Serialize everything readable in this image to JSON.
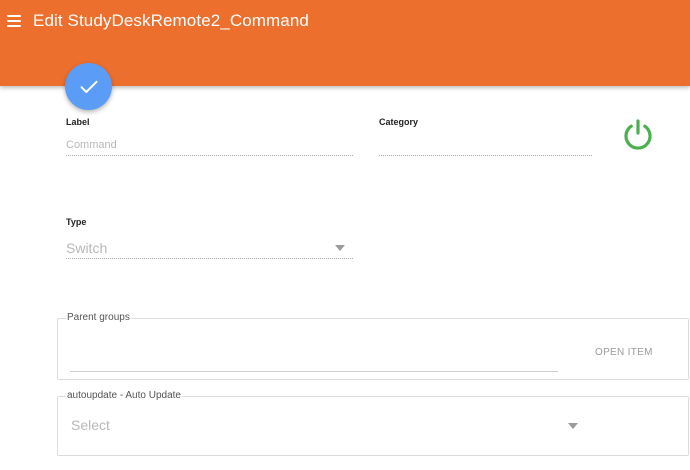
{
  "header": {
    "title": "Edit StudyDeskRemote2_Command",
    "background": "#ec6f2e"
  },
  "fab": {
    "icon": "check-icon",
    "color": "#5b9cf6"
  },
  "form": {
    "label": {
      "caption": "Label",
      "placeholder": "Command"
    },
    "category": {
      "caption": "Category",
      "value": ""
    },
    "power": {
      "icon": "power-icon",
      "color": "#4caf50"
    },
    "type": {
      "caption": "Type",
      "selected": "Switch"
    },
    "parent_groups": {
      "legend": "Parent groups",
      "action": "OPEN ITEM",
      "value": ""
    },
    "autoupdate": {
      "legend": "autoupdate - Auto Update",
      "selected": "Select"
    }
  }
}
